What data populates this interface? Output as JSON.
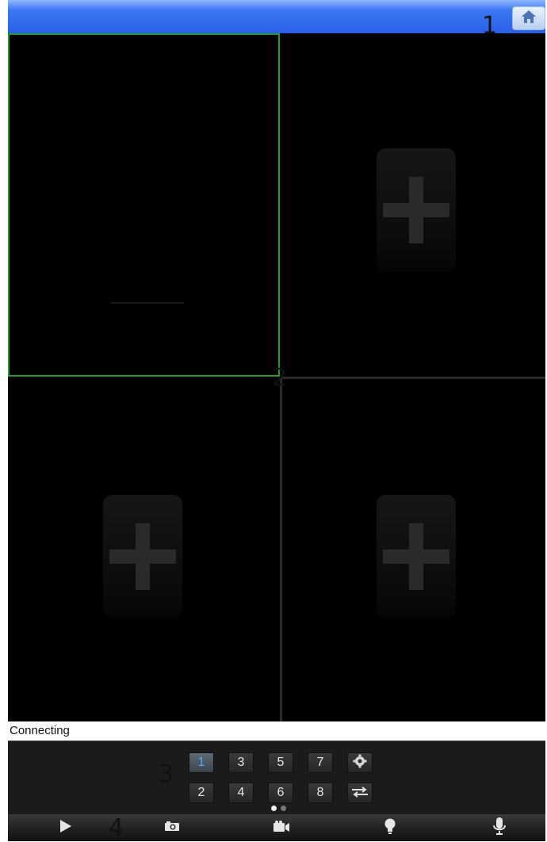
{
  "header": {
    "home_icon": "home-icon"
  },
  "callouts": {
    "c1": "1",
    "c2": "2",
    "c3": "3",
    "c4": "4"
  },
  "video": {
    "selected_border_color": "#1f9e2a",
    "slots": [
      {
        "id": 1,
        "state": "connecting"
      },
      {
        "id": 2,
        "state": "empty",
        "icon": "add-camera-icon"
      },
      {
        "id": 3,
        "state": "empty",
        "icon": "add-camera-icon"
      },
      {
        "id": 4,
        "state": "empty",
        "icon": "add-camera-icon"
      }
    ]
  },
  "status": {
    "text": "Connecting"
  },
  "channels": {
    "buttons": [
      "1",
      "3",
      "5",
      "7",
      "2",
      "4",
      "6",
      "8"
    ],
    "selected": "1",
    "settings_icon": "gear-icon",
    "switch_icon": "switch-arrows-icon",
    "page_dots": {
      "count": 2,
      "current": 1
    }
  },
  "toolbar": {
    "icons": [
      "play-icon",
      "camera-snapshot-icon",
      "video-record-icon",
      "light-bulb-icon",
      "microphone-icon"
    ]
  },
  "colors": {
    "topbar": "#2a5fe8",
    "active_channel_text": "#4fb0ff"
  }
}
